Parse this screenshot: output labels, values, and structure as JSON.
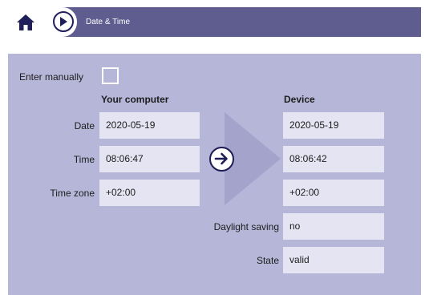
{
  "header": {
    "home_icon": "home-icon",
    "play_icon": "play-icon",
    "title": "Date & Time"
  },
  "manual": {
    "label": "Enter manually",
    "checked": false
  },
  "computer": {
    "heading": "Your computer",
    "date_label": "Date",
    "date": "2020-05-19",
    "time_label": "Time",
    "time": "08:06:47",
    "tz_label": "Time zone",
    "tz": "+02:00"
  },
  "device": {
    "heading": "Device",
    "date": "2020-05-19",
    "time": "08:06:42",
    "tz": "+02:00",
    "dst_label": "Daylight saving",
    "dst": "no",
    "state_label": "State",
    "state": "valid"
  },
  "transfer_icon": "arrow-right-circle-icon",
  "colors": {
    "header_bg": "#5f5d8f",
    "panel_bg": "#b6b6d9",
    "field_bg": "#e4e4f3",
    "icon_dark": "#211f5a"
  }
}
